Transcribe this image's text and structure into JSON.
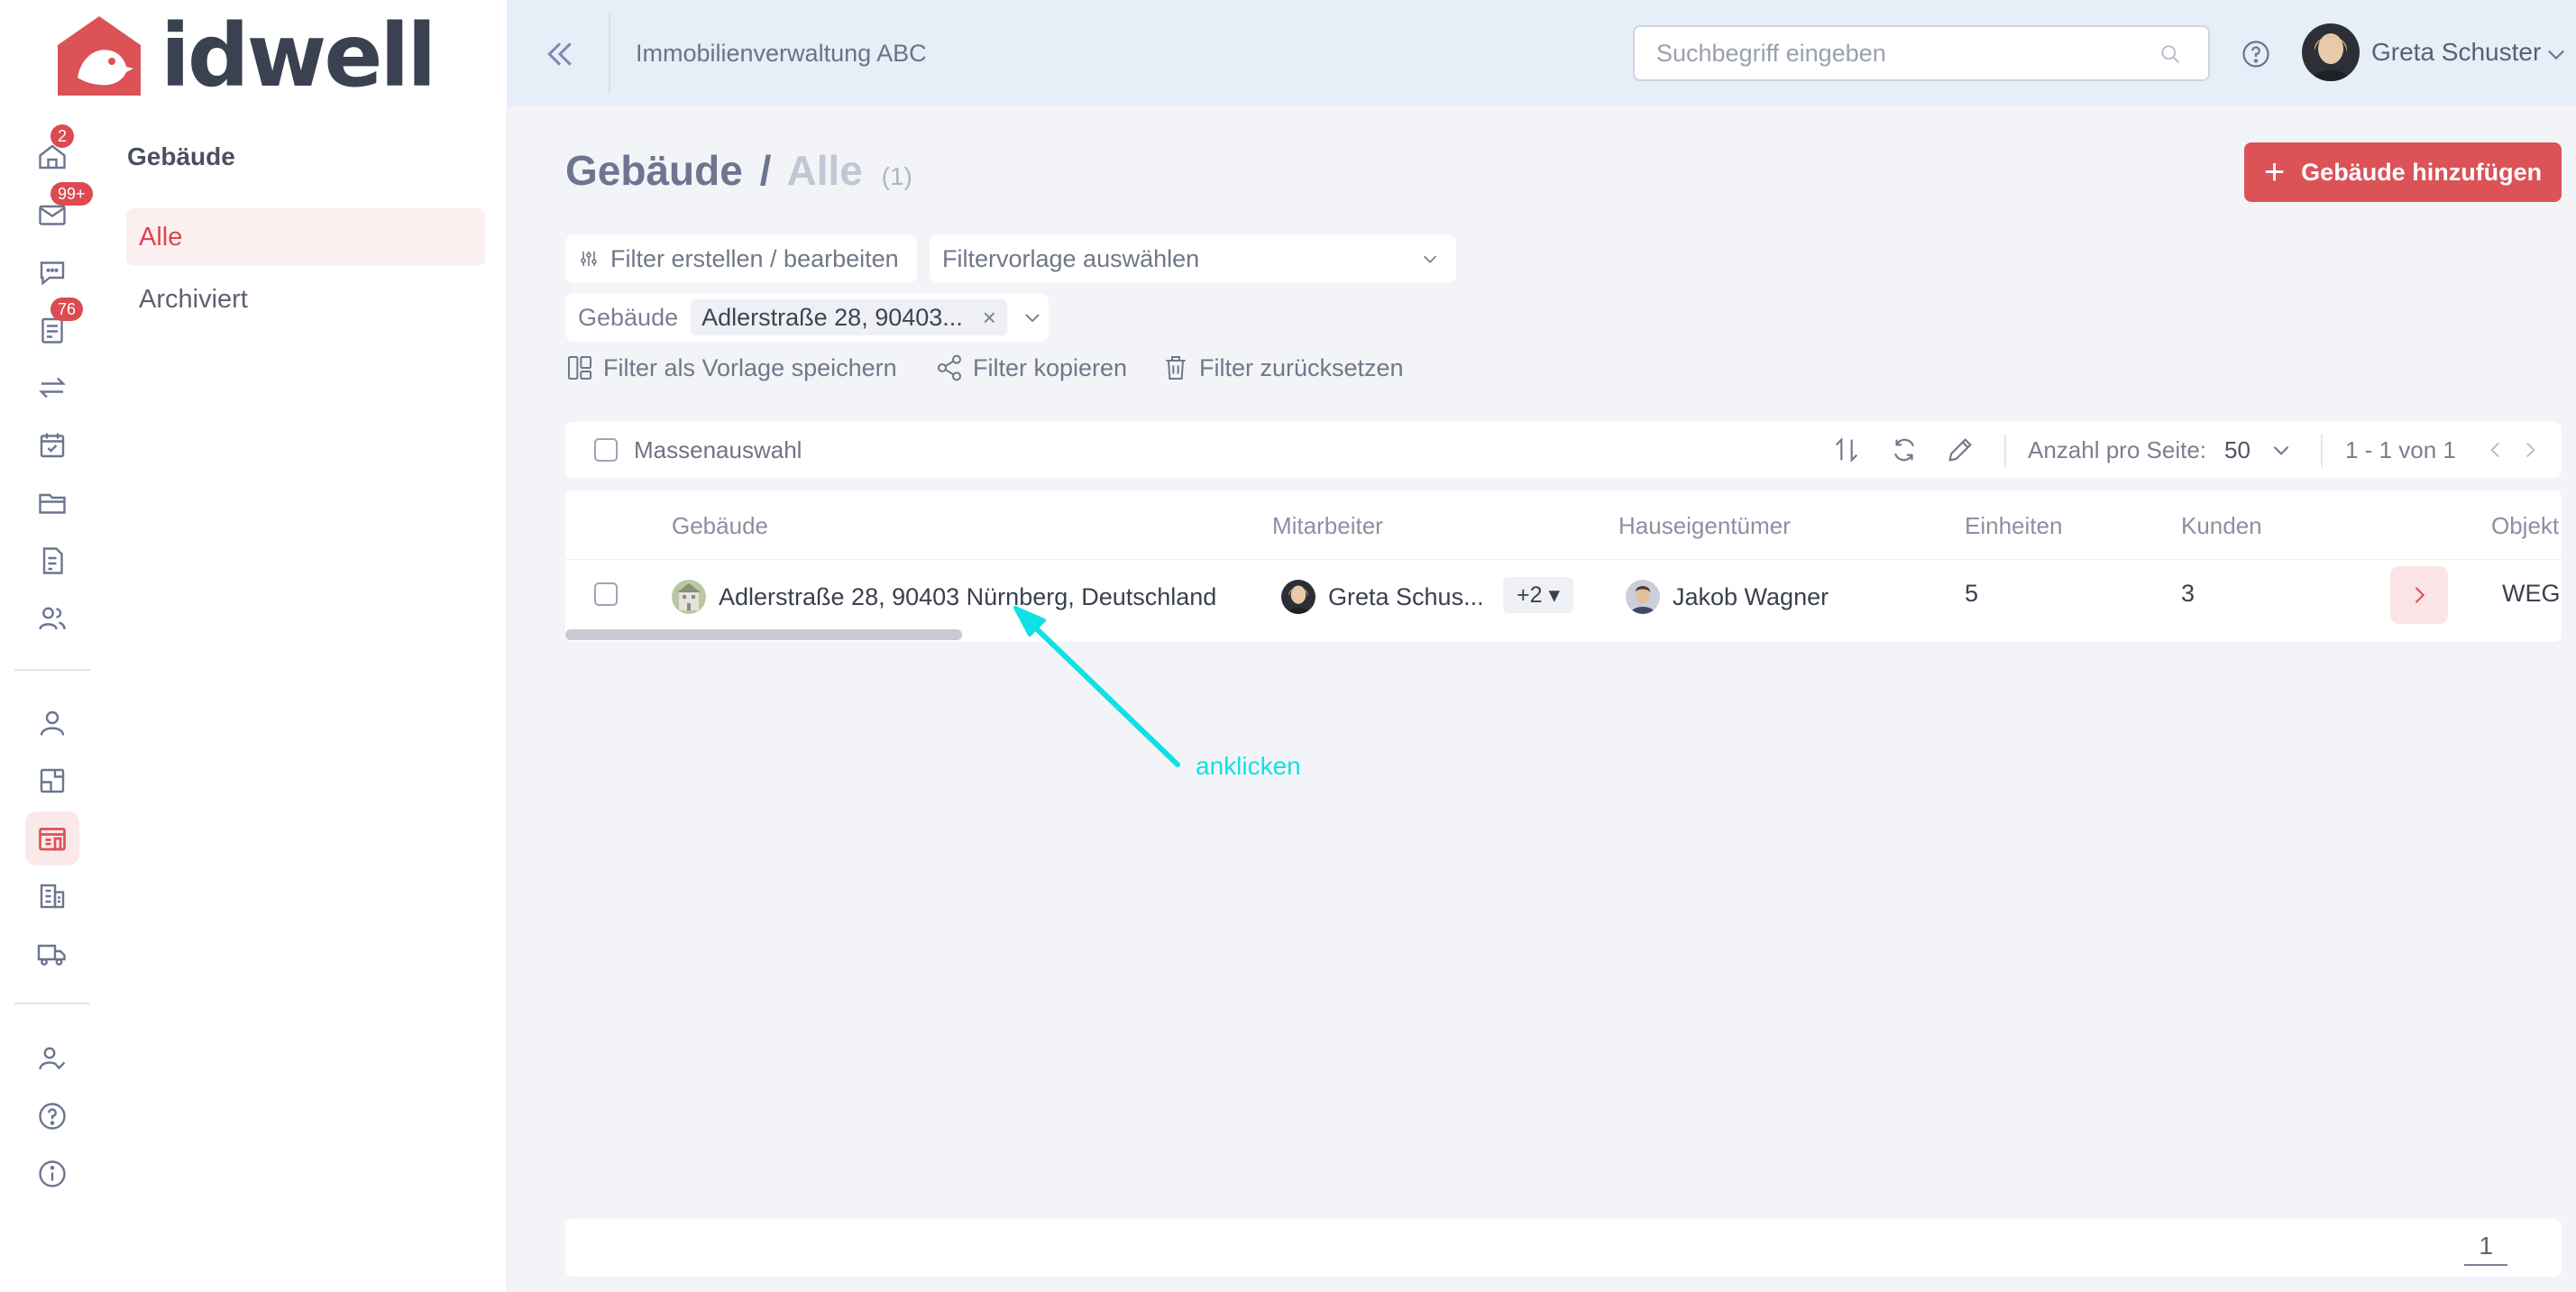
{
  "app": {
    "logo_text": "idwell",
    "org_name": "Immobilienverwaltung ABC",
    "brand_color": "#db5257"
  },
  "rail": {
    "badges": {
      "dashboard": "2",
      "messages": "99+",
      "tasks": "76"
    },
    "icons": [
      "home-icon",
      "mail-icon",
      "chat-icon",
      "tasks-icon",
      "transfer-icon",
      "calendar-icon",
      "folder-icon",
      "document-icon",
      "users-icon",
      "person-icon",
      "unit-icon",
      "building-active-icon",
      "buildings-icon",
      "truck-icon",
      "user-check-icon",
      "help-icon",
      "info-icon"
    ]
  },
  "submenu": {
    "title": "Gebäude",
    "items": [
      {
        "label": "Alle",
        "active": true
      },
      {
        "label": "Archiviert",
        "active": false
      }
    ]
  },
  "topbar": {
    "search_placeholder": "Suchbegriff eingeben",
    "user_name": "Greta Schuster"
  },
  "page": {
    "title_root": "Gebäude",
    "title_sep": "/",
    "title_current": "Alle",
    "title_count": "(1)",
    "add_button": "Gebäude hinzufügen"
  },
  "filters": {
    "edit_label": "Filter erstellen / bearbeiten",
    "template_placeholder": "Filtervorlage auswählen",
    "active_field": "Gebäude",
    "active_value": "Adlerstraße 28, 90403...",
    "save_template": "Filter als Vorlage speichern",
    "copy": "Filter kopieren",
    "reset": "Filter zurücksetzen"
  },
  "toolbar": {
    "mass_select": "Massenauswahl",
    "per_page_label": "Anzahl pro Seite:",
    "per_page_value": "50",
    "page_range": "1 - 1 von 1"
  },
  "table": {
    "columns": [
      "Gebäude",
      "Mitarbeiter",
      "Hauseigentümer",
      "Einheiten",
      "Kunden",
      "Objekt"
    ],
    "rows": [
      {
        "building": "Adlerstraße 28, 90403 Nürnberg, Deutschland",
        "employee": "Greta Schus...",
        "employee_more": "+2 ▾",
        "owner": "Jakob Wagner",
        "units": "5",
        "customers": "3",
        "object": "WEG"
      }
    ]
  },
  "annotation": {
    "text": "anklicken",
    "color": "#11e0e4"
  },
  "footer": {
    "current_page": "1"
  }
}
